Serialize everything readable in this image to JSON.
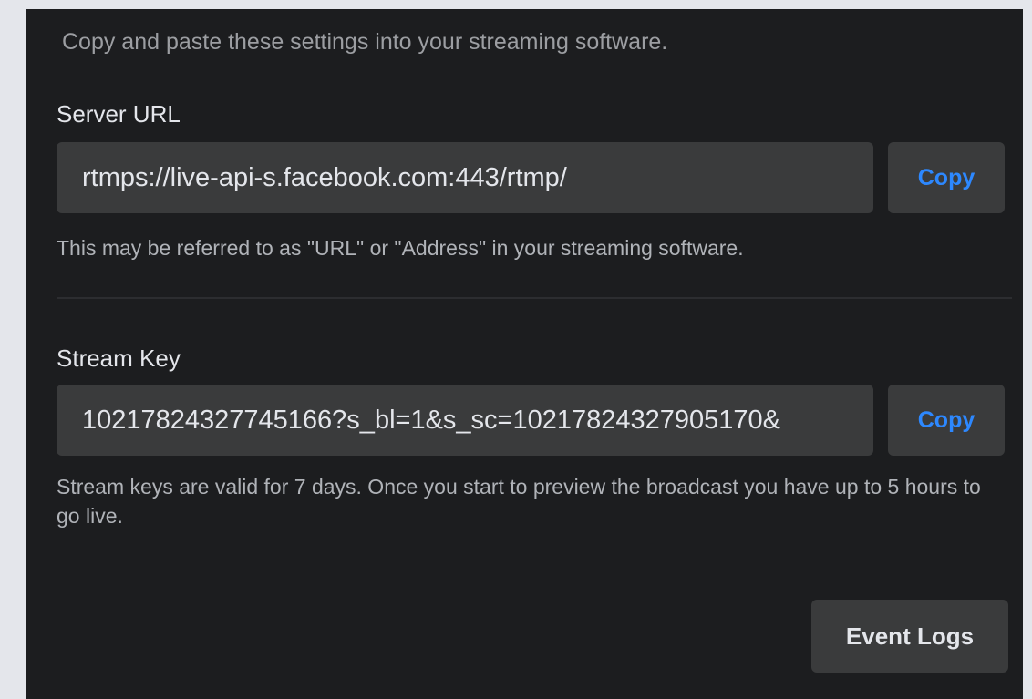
{
  "subtitle": "Copy and paste these settings into your streaming software.",
  "server_url": {
    "label": "Server URL",
    "value": "rtmps://live-api-s.facebook.com:443/rtmp/",
    "copy_label": "Copy",
    "help": "This may be referred to as \"URL\" or \"Address\" in your streaming software."
  },
  "stream_key": {
    "label": "Stream Key",
    "value": "10217824327745166?s_bl=1&s_sc=10217824327905170&",
    "copy_label": "Copy",
    "help": "Stream keys are valid for 7 days. Once you start to preview the broadcast you have up to 5 hours to go live."
  },
  "event_logs_label": "Event Logs",
  "colors": {
    "panel_bg": "#1c1d1f",
    "field_bg": "#3a3b3c",
    "accent": "#2d88ff"
  }
}
